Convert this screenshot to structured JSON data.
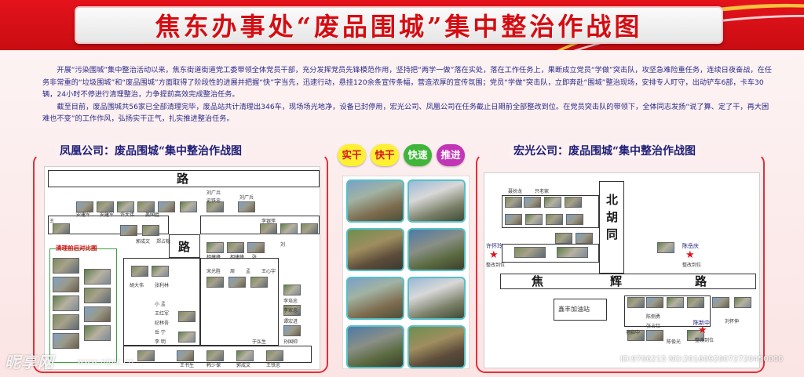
{
  "banner": {
    "title": "焦东办事处“废品围城”集中整治作战图"
  },
  "intro": {
    "paragraph1": "开展“污染围城”集中整治活动以来，焦东街道街道党工委带领全体党员干部，充分发挥党员先锋模范作用，坚持把“两学一做”落在实处，落在工作任务上，果断成立党员“学做”突击队，攻坚急难险重任务，连续日夜奋战，在任务非常重的“垃圾围城”和“废品围城”方面取得了阶段性的进展并把握“快”字当先，迅速行动，悬挂120余条宣传条幅，营造浓厚的宣传氛围；党员“学做”突击队，立即奔赴“围城”整治现场，安排专人盯守，出动铲车6部，卡车30辆，24小时不停进行清理整治，力争提前高效完成整治任务。",
    "paragraph2": "截至目前，废品围城共56家已全部清理完毕，废品站共计清理出346车，现场场光地净，设备已封停用，宏光公司、凤凰公司在任务截止日期前全部整改到位。在党员突击队的带领下，全体同志发扬“说了算、定了干，再大困难也不变”的工作作风，弘扬实干正气，扎实推进整治任务。"
  },
  "slogans": [
    "实干",
    "快干",
    "快速",
    "推进"
  ],
  "left_panel": {
    "title": "凤凰公司：废品围城“集中整治作战图",
    "road_top": "路",
    "road_mid": "路",
    "compare_title": "清理前后对比图",
    "labels": [
      "王",
      "安建军",
      "安建军",
      "许大伟",
      "姜国胜",
      "刘广兵",
      "史铁忠",
      "刘广兵",
      "李银萍",
      "郭成文",
      "郑占稳",
      "相建峰",
      "相建峰",
      "张",
      "刘",
      "胡大伟",
      "张利林",
      "宋光胜",
      "周",
      "孟",
      "王心宇",
      "李培忠",
      "小 孟",
      "王红军",
      "纪林吾",
      "岳 宁",
      "李 明",
      "李家忠",
      "谭宏进",
      "孙国帅",
      "于弘生",
      "王书生",
      "韩少保",
      "郭成文",
      "王铁忠"
    ]
  },
  "right_panel": {
    "title": "宏光公司：废品围城“集中整治作战图",
    "road_v": [
      "北",
      "胡",
      "同"
    ],
    "road_h": [
      "焦",
      "辉",
      "路"
    ],
    "gas_station": "鑫丰加油站",
    "star_left_name": "许怀玲",
    "star_left_sub": "整改到位",
    "star_right_name": "陈岳庆",
    "star_right_sub": "整改到位",
    "star_bottom_name": "陈新中",
    "star_bottom_sub": "整改到位",
    "labels": [
      "聂扮龙",
      "只老家",
      "孙启中",
      "陈侧勇",
      "刘怀伸",
      "张占红",
      "陈俊光"
    ]
  },
  "watermark": {
    "logo": "昵享网",
    "url": "www.nipic.cn",
    "id": "ID:9706215 NO:20160920072720450000"
  }
}
